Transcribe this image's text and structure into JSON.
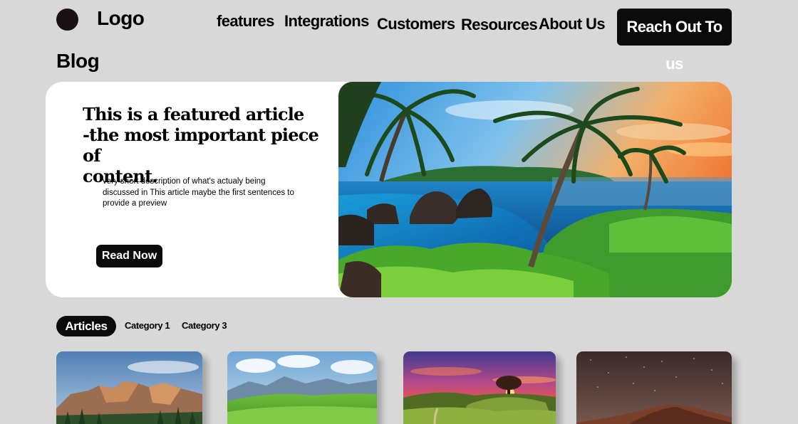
{
  "header": {
    "logo_label": "Logo",
    "nav": {
      "features": "features",
      "integrations": "Integrations",
      "customers": "Customers",
      "resources": "Resources",
      "about": "About Us"
    },
    "cta_label": "Reach Out To  us"
  },
  "blog": {
    "title": "Blog"
  },
  "featured": {
    "title_line1": "This is a featured article",
    "title_line2": "-the most important piece of",
    "title_line3": "content.",
    "description": "very short description of what's actualy being discussed in This article maybe the first sentences to provide  a preview",
    "read_button": "Read Now"
  },
  "categories": {
    "active": "Articles",
    "items": [
      "Category 1",
      "Category 3"
    ]
  },
  "colors": {
    "background": "#d8d8d8",
    "card": "#ffffff",
    "button": "#0b0b0b",
    "logo_dot": "#1b1013"
  }
}
